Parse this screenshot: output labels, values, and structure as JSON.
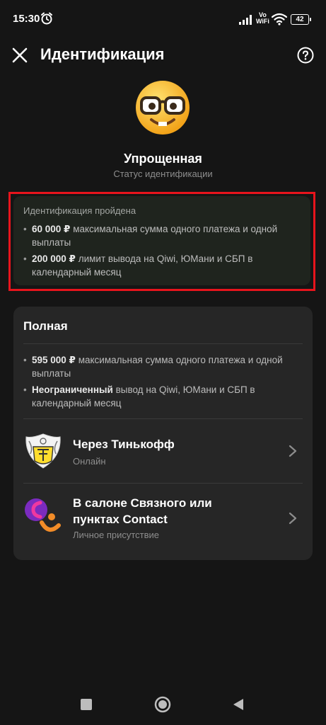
{
  "status_bar": {
    "time": "15:30",
    "volte_top": "Vo",
    "volte_bottom": "WiFi",
    "battery": "42",
    "icons": [
      "alarm-icon",
      "signal-icon",
      "wifi-icon",
      "battery-icon"
    ]
  },
  "header": {
    "title": "Идентификация",
    "close_icon": "close-icon",
    "help_icon": "help-icon"
  },
  "current_level": {
    "emoji": "nerd-face-emoji",
    "title": "Упрощенная",
    "subtitle": "Статус идентификации"
  },
  "passed_card": {
    "heading": "Идентификация пройдена",
    "bullets": [
      {
        "bold": "60 000 ₽",
        "text": " максимальная сумма одного платежа и одной выплаты"
      },
      {
        "bold": "200 000 ₽",
        "text": " лимит вывода на Qiwi, ЮМани и СБП в календарный месяц"
      }
    ]
  },
  "full_card": {
    "title": "Полная",
    "bullets": [
      {
        "bold": "595 000 ₽",
        "text": " максимальная сумма одного платежа и одной выплаты"
      },
      {
        "bold": "Неограниченный",
        "text": " вывод на Qiwi, ЮМани и СБП в календарный месяц"
      }
    ],
    "options": [
      {
        "title": "Через Тинькофф",
        "subtitle": "Онлайн",
        "logo": "tinkoff-logo"
      },
      {
        "title_line1": "В салоне Связного или",
        "title_line2": "пунктах Contact",
        "subtitle": "Личное присутствие",
        "logo": "svyaznoy-contact-logo"
      }
    ]
  },
  "colors": {
    "background": "#151515",
    "card": "#262626",
    "passed_card": "#1f241e",
    "highlight": "#e8141c"
  }
}
